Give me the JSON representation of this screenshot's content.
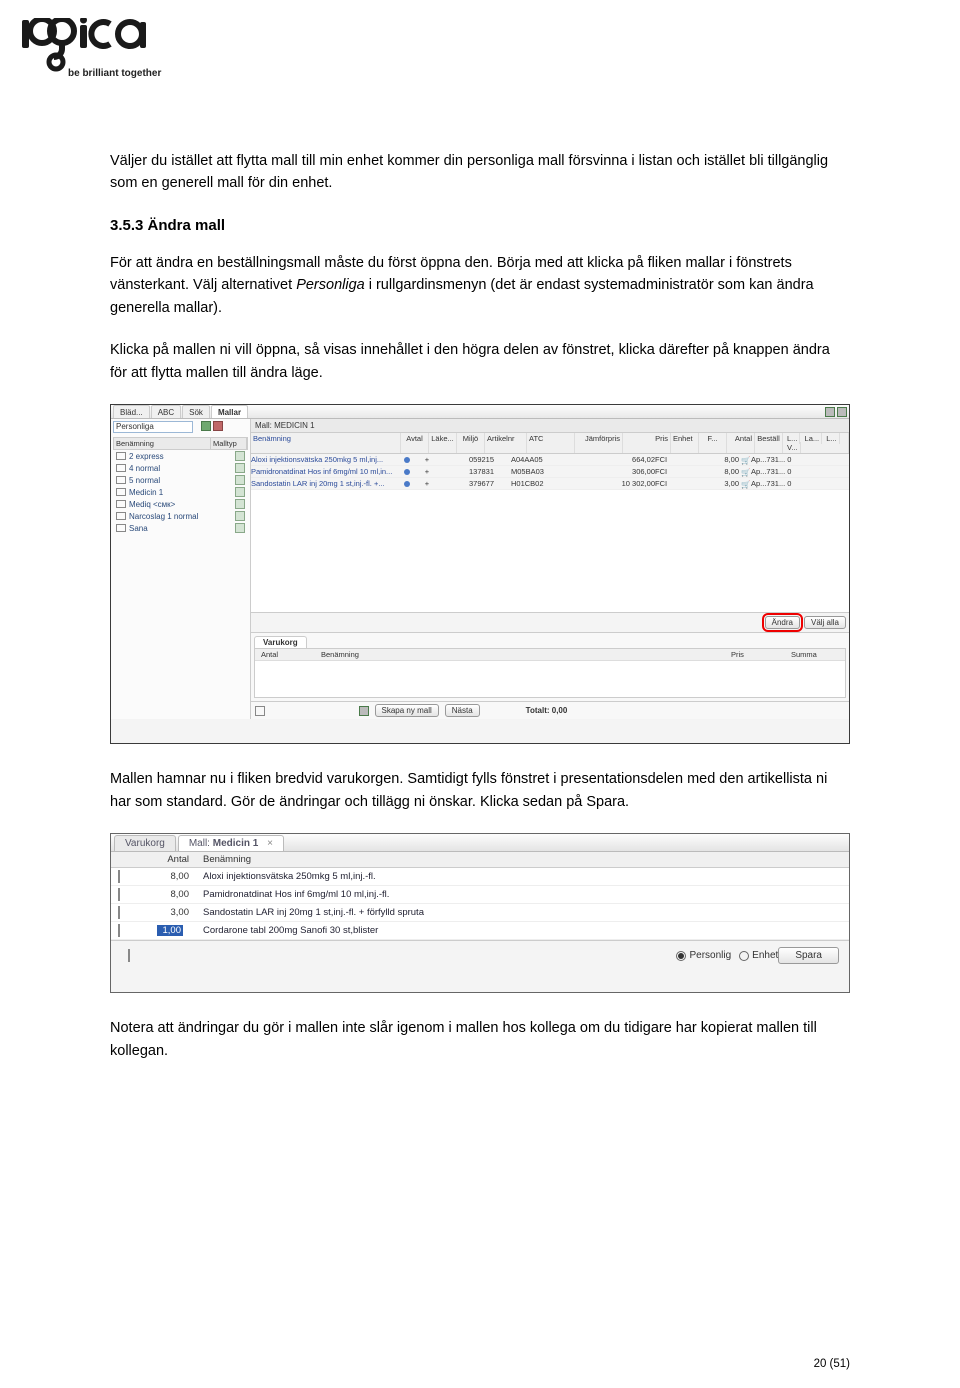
{
  "logo": {
    "tagline": "be brilliant together"
  },
  "body": {
    "p1": "Väljer du istället att flytta mall till min enhet kommer din personliga mall försvinna i listan och istället bli tillgänglig som en generell mall för din enhet.",
    "h1": "3.5.3 Ändra mall",
    "p2a": "För att ändra en beställningsmall måste du först öppna den. Börja med att klicka på fliken mallar i fönstrets vänsterkant. Välj alternativet ",
    "p2b": "Personliga",
    "p2c": " i rullgardinsmenyn (det är endast systemadministratör som kan ändra generella mallar).",
    "p3": "Klicka på mallen ni vill öppna, så visas innehållet i den högra delen av fönstret, klicka därefter på knappen ändra för att flytta mallen till ändra läge.",
    "p4": "Mallen hamnar nu i fliken bredvid varukorgen. Samtidigt fylls fönstret i presentationsdelen med den artikellista ni har som standard. Gör de ändringar och tillägg ni önskar. Klicka sedan på Spara.",
    "p5": "Notera att ändringar du gör i mallen inte slår igenom i mallen hos kollega om du tidigare har kopierat mallen till kollegan."
  },
  "ss1": {
    "tabs": [
      "Bläd...",
      "ABC",
      "Sök",
      "Mallar"
    ],
    "dropdown": "Personliga",
    "listhead": [
      "Benämning",
      "Malltyp"
    ],
    "items": [
      "2 express",
      "4 normal",
      "5 normal",
      "Medicin 1",
      "Mediq <смк>",
      "Narcoslag 1 normal",
      "Sana"
    ],
    "title": "Mall: MEDICIN 1",
    "gridhead": [
      "Benämning",
      "Avtal",
      "Läke...",
      "Miljö",
      "Artikelnr",
      "ATC",
      "Jämförpris",
      "Pris",
      "Enhet",
      "F...",
      "Antal",
      "Beställ",
      "L...",
      "La...",
      "L...",
      "V..."
    ],
    "rows": [
      {
        "ben": "Aloxi injektionsvätska 250mkg 5 ml,inj...",
        "art": "059215",
        "atc": "A04AA05",
        "pris": "664,02",
        "enh": "FCI",
        "ant": "8,00",
        "rest": "Ap...731...  0"
      },
      {
        "ben": "Pamidronatdinat Hos inf 6mg/ml 10 ml,in...",
        "art": "137831",
        "atc": "M05BA03",
        "pris": "306,00",
        "enh": "FCI",
        "ant": "8,00",
        "rest": "Ap...731...  0"
      },
      {
        "ben": "Sandostatin LAR inj 20mg 1 st,inj.-fl. +...",
        "art": "379677",
        "atc": "H01CB02",
        "pris": "10 302,00",
        "enh": "FCI",
        "ant": "3,00",
        "rest": "Ap...731...  0"
      }
    ],
    "btn_andra": "Ändra",
    "btn_valjalla": "Välj alla",
    "cart_tab": "Varukorg",
    "cart_heads": [
      "Antal",
      "Benämning",
      "Pris",
      "Summa"
    ],
    "btn_skapa": "Skapa ny mall",
    "btn_nasta": "Nästa",
    "total": "Totalt: 0,00"
  },
  "ss2": {
    "tab1": "Varukorg",
    "tab2_pref": "Mall: ",
    "tab2_bold": "Medicin 1",
    "head_antal": "Antal",
    "head_ben": "Benämning",
    "rows": [
      {
        "antal": "8,00",
        "ben": "Aloxi injektionsvätska 250mkg 5 ml,inj.-fl.",
        "hl": false
      },
      {
        "antal": "8,00",
        "ben": "Pamidronatdinat Hos inf 6mg/ml 10 ml,inj.-fl.",
        "hl": false
      },
      {
        "antal": "3,00",
        "ben": "Sandostatin LAR inj 20mg 1 st,inj.-fl. + förfylld spruta",
        "hl": false
      },
      {
        "antal": "1,00",
        "ben": "Cordarone tabl 200mg Sanofi 30 st,blister",
        "hl": true
      }
    ],
    "radio1": "Personlig",
    "radio2": "Enhet",
    "btn_spara": "Spara"
  },
  "page_num": "20 (51)"
}
